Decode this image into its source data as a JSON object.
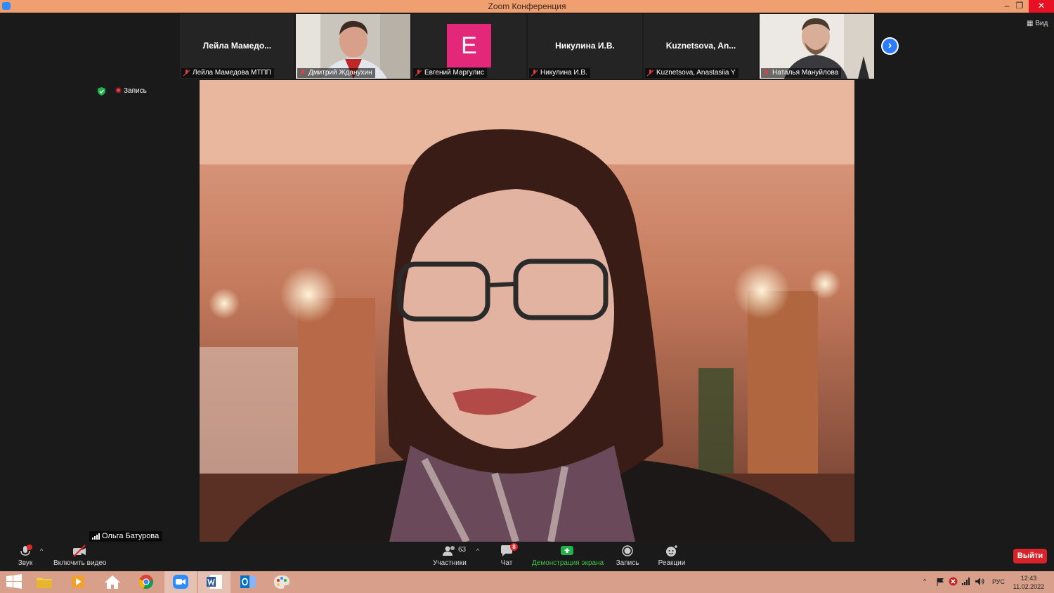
{
  "window": {
    "title": "Zoom Конференция",
    "controls": {
      "minimize": "–",
      "maximize": "❐",
      "close": "✕"
    }
  },
  "gallery": {
    "tiles": [
      {
        "big_name": "Лейла  Мамедо...",
        "caption": "Лейла Мамедова МТПП"
      },
      {
        "big_name": "",
        "caption": "Дмитрий Жданухин"
      },
      {
        "big_name": "",
        "caption": "Евгений Маргулис",
        "avatar_letter": "E"
      },
      {
        "big_name": "Никулина И.В.",
        "caption": "Никулина И.В."
      },
      {
        "big_name": "Kuznetsova,  An...",
        "caption": "Kuznetsova, Anastasiia Y"
      },
      {
        "big_name": "",
        "caption": "Наталья Мануйлова"
      }
    ],
    "next_glyph": "›",
    "view_label": "Вид"
  },
  "status": {
    "recording_label": "Запись"
  },
  "main_video": {
    "speaker_name": "Ольга Батурова"
  },
  "toolbar": {
    "audio_label": "Звук",
    "video_label": "Включить видео",
    "participants_label": "Участники",
    "participants_count": "63",
    "chat_label": "Чат",
    "chat_badge": "8",
    "share_label": "Демонстрация экрана",
    "record_label": "Запись",
    "reactions_label": "Реакции",
    "leave_label": "Выйти",
    "caret": "^"
  },
  "taskbar": {
    "language": "РУС",
    "time": "12:43",
    "date": "11.02.2022"
  },
  "colors": {
    "accent": "#2d8cff",
    "title_bar": "#f0a070",
    "taskbar": "#d8a08a",
    "leave": "#d8232a",
    "share_green": "#3ec24a",
    "avatar_pink": "#e3287a"
  }
}
